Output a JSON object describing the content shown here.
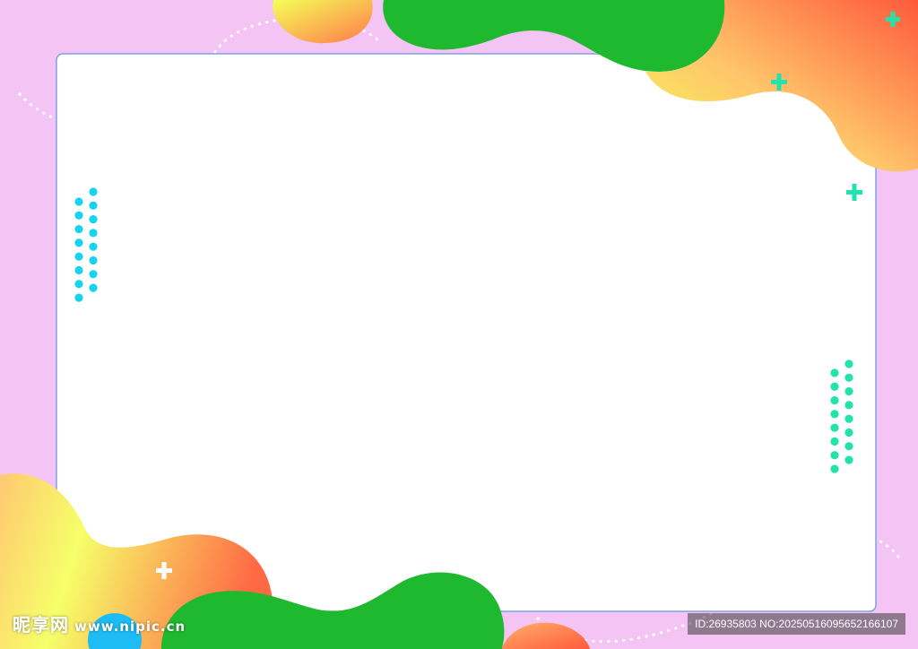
{
  "background_color": "#f3c4f4",
  "frame": {
    "fill": "#ffffff",
    "stroke": "#7ea2e6"
  },
  "colors": {
    "green_blob": "#1eb92e",
    "gradient_warm_start": "#f4ff58",
    "gradient_warm_end": "#ff5a3c",
    "dots_left": "#18d3f0",
    "dots_right": "#21e3ab",
    "plus_accent": "#21e3ab",
    "bubble": "#1ebcf4"
  },
  "icons": [
    "plus-icon",
    "dot-pattern",
    "dotted-arc"
  ],
  "watermark": {
    "brand": "昵享网",
    "site": "www.nipic.cn",
    "id_line": "ID:26935803 NO:20250516095652166107"
  }
}
